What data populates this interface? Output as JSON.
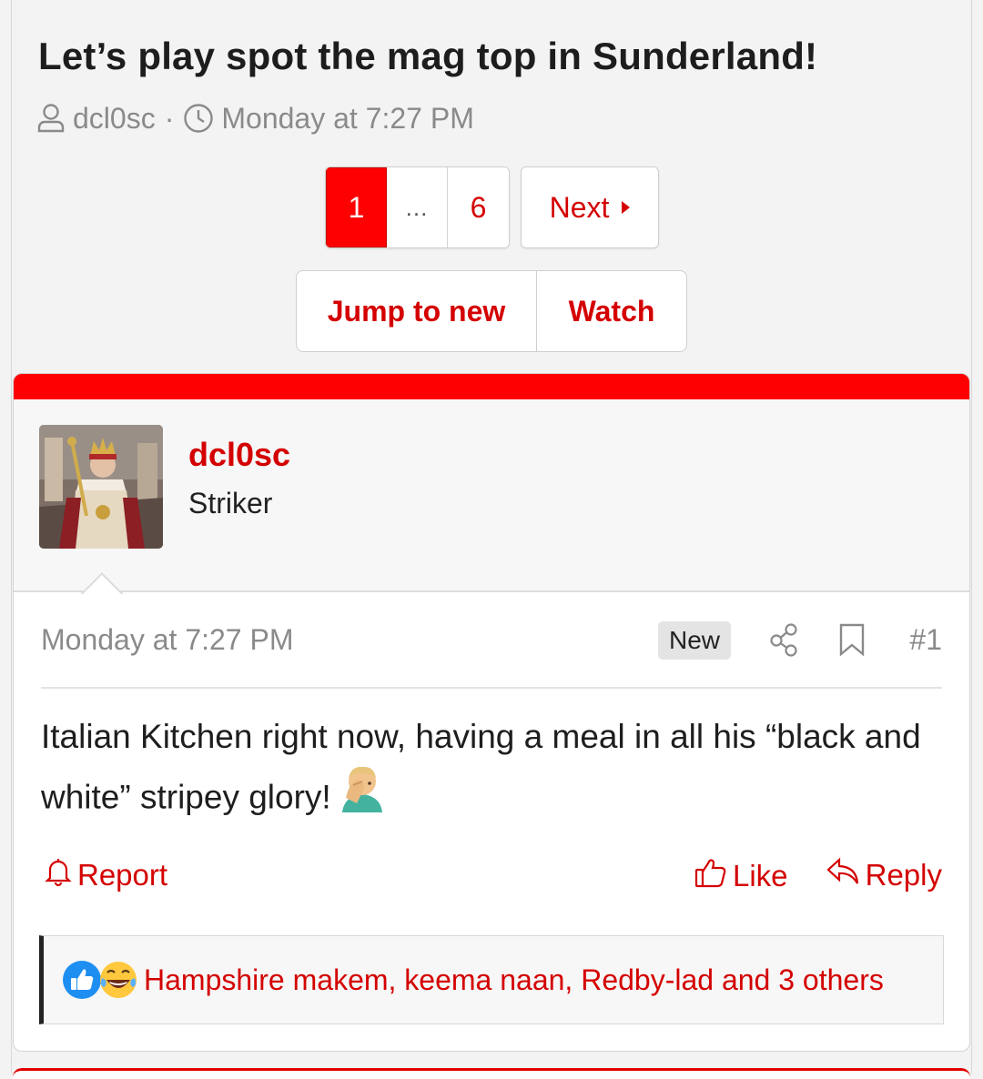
{
  "thread": {
    "title": "Let’s play spot the mag top in Sunderland!",
    "author": "dcl0sc",
    "separator": "·",
    "date": "Monday at 7:27 PM"
  },
  "pagination": {
    "pages": [
      "1",
      "…",
      "6"
    ],
    "current": "1",
    "next_label": "Next"
  },
  "actions": {
    "jump_label": "Jump to new",
    "watch_label": "Watch"
  },
  "post": {
    "username": "dcl0sc",
    "user_title": "Striker",
    "date": "Monday at 7:27 PM",
    "badge": "New",
    "number": "#1",
    "body": "Italian Kitchen right now, having a meal in all his “black and white” stripey glory!",
    "actions": {
      "report": "Report",
      "like": "Like",
      "reply": "Reply"
    },
    "reactions_text": "Hampshire makem, keema naan, Redby-lad and 3 others",
    "reaction_icons": [
      "like-reaction-icon",
      "laugh-reaction-icon"
    ]
  },
  "colors": {
    "accent": "#d40000",
    "active_page": "#ff0000",
    "meta_text": "#8a8a8a"
  }
}
